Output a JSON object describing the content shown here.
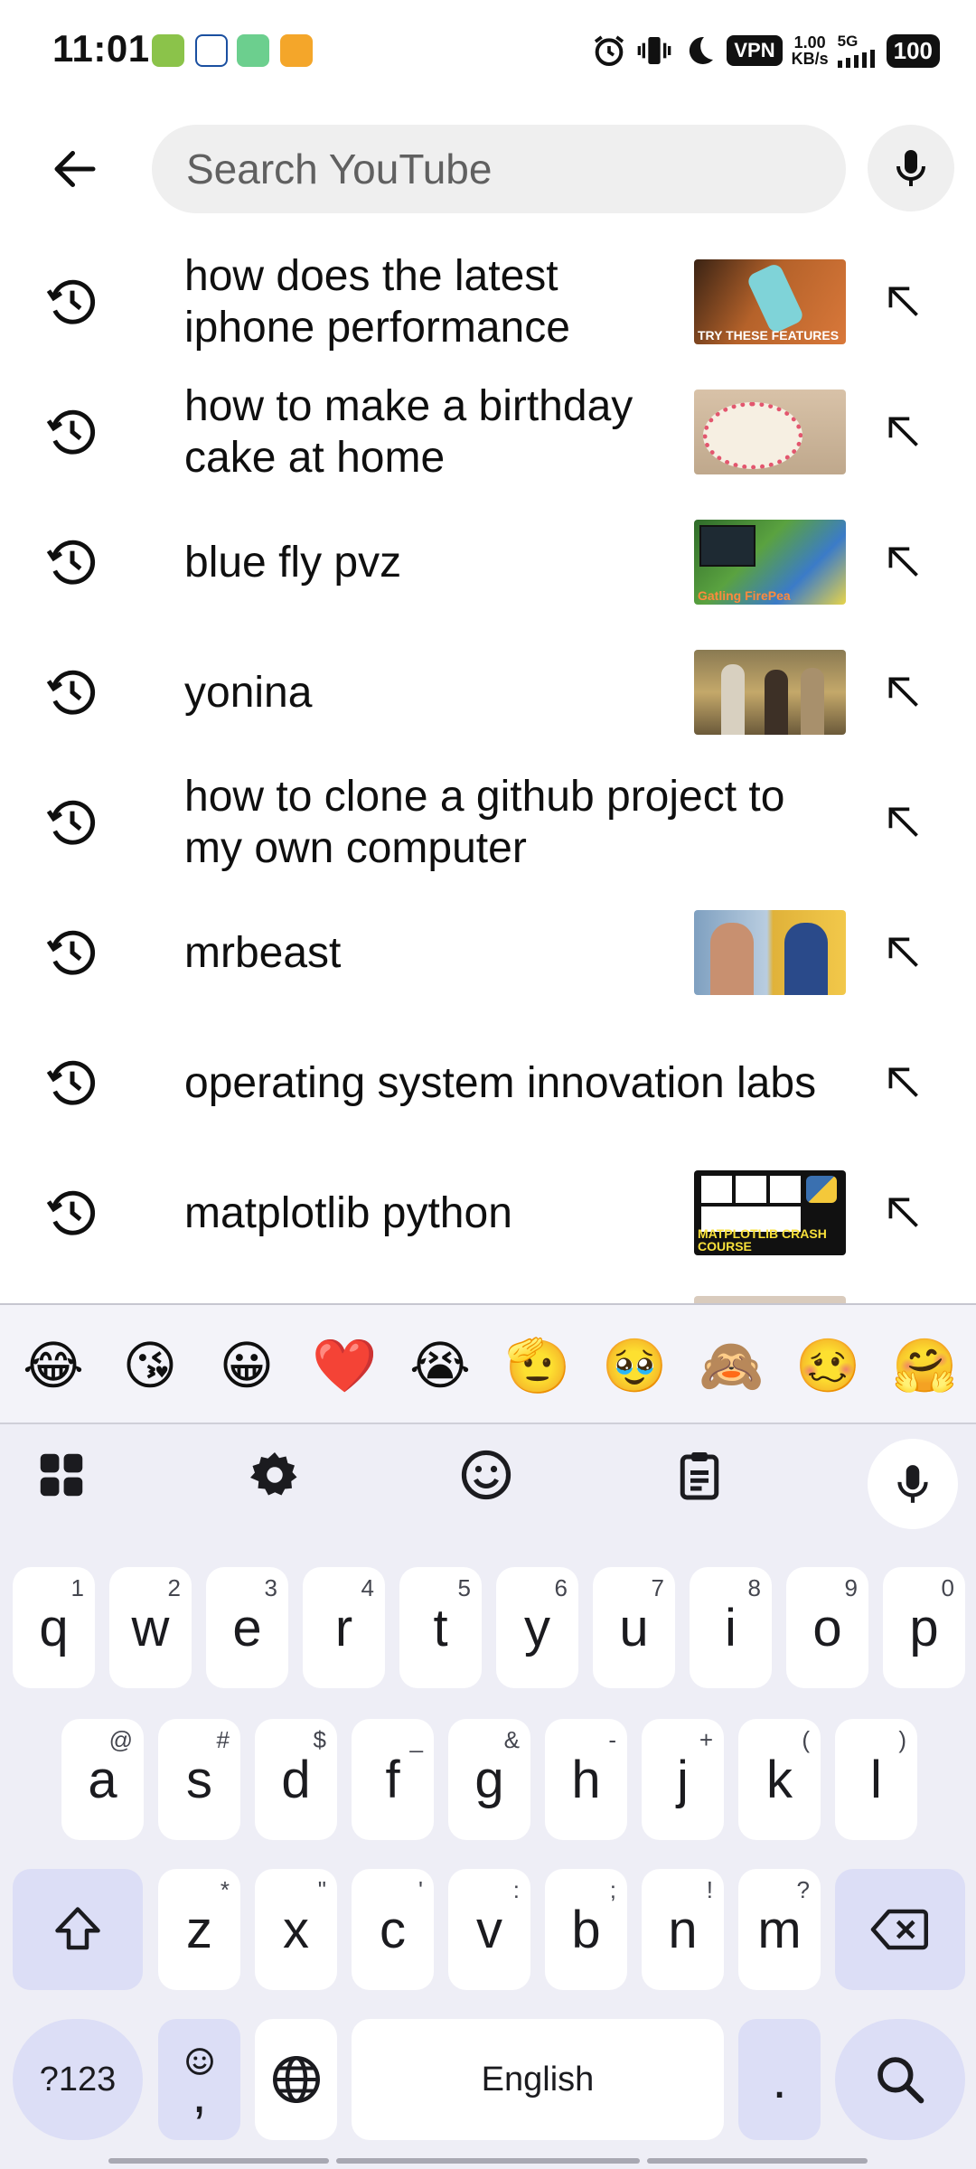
{
  "status_bar": {
    "time": "11:01",
    "vpn": "VPN",
    "speed_value": "1.00",
    "speed_unit": "KB/s",
    "network": "5G",
    "battery": "100"
  },
  "search": {
    "placeholder": "Search YouTube",
    "value": ""
  },
  "suggestions": [
    {
      "text": "how does the latest iphone performance",
      "thumb_caption": "TRY THESE FEATURES"
    },
    {
      "text": "how to make a birthday cake at home",
      "thumb_caption": ""
    },
    {
      "text": "blue fly pvz",
      "thumb_caption": "Gatling FirePea"
    },
    {
      "text": "yonina",
      "thumb_caption": ""
    },
    {
      "text": "how to clone a github project to my own computer",
      "thumb_caption": ""
    },
    {
      "text": "mrbeast",
      "thumb_caption": ""
    },
    {
      "text": "operating system innovation labs",
      "thumb_caption": ""
    },
    {
      "text": "matplotlib python",
      "thumb_caption": "MATPLOTLIB CRASH COURSE"
    }
  ],
  "keyboard": {
    "emojis": [
      "😂",
      "😘",
      "😀",
      "❤️",
      "😭",
      "🫡",
      "🥹",
      "🙈",
      "🥴",
      "🤗"
    ],
    "row1": [
      {
        "k": "q",
        "h": "1"
      },
      {
        "k": "w",
        "h": "2"
      },
      {
        "k": "e",
        "h": "3"
      },
      {
        "k": "r",
        "h": "4"
      },
      {
        "k": "t",
        "h": "5"
      },
      {
        "k": "y",
        "h": "6"
      },
      {
        "k": "u",
        "h": "7"
      },
      {
        "k": "i",
        "h": "8"
      },
      {
        "k": "o",
        "h": "9"
      },
      {
        "k": "p",
        "h": "0"
      }
    ],
    "row2": [
      {
        "k": "a",
        "h": "@"
      },
      {
        "k": "s",
        "h": "#"
      },
      {
        "k": "d",
        "h": "$"
      },
      {
        "k": "f",
        "h": "_"
      },
      {
        "k": "g",
        "h": "&"
      },
      {
        "k": "h",
        "h": "-"
      },
      {
        "k": "j",
        "h": "+"
      },
      {
        "k": "k",
        "h": "("
      },
      {
        "k": "l",
        "h": ")"
      }
    ],
    "row3": [
      {
        "k": "z",
        "h": "*"
      },
      {
        "k": "x",
        "h": "\""
      },
      {
        "k": "c",
        "h": "'"
      },
      {
        "k": "v",
        "h": ":"
      },
      {
        "k": "b",
        "h": ";"
      },
      {
        "k": "n",
        "h": "!"
      },
      {
        "k": "m",
        "h": "?"
      }
    ],
    "symbols_label": "?123",
    "comma": ",",
    "space_label": "English",
    "period": "."
  }
}
